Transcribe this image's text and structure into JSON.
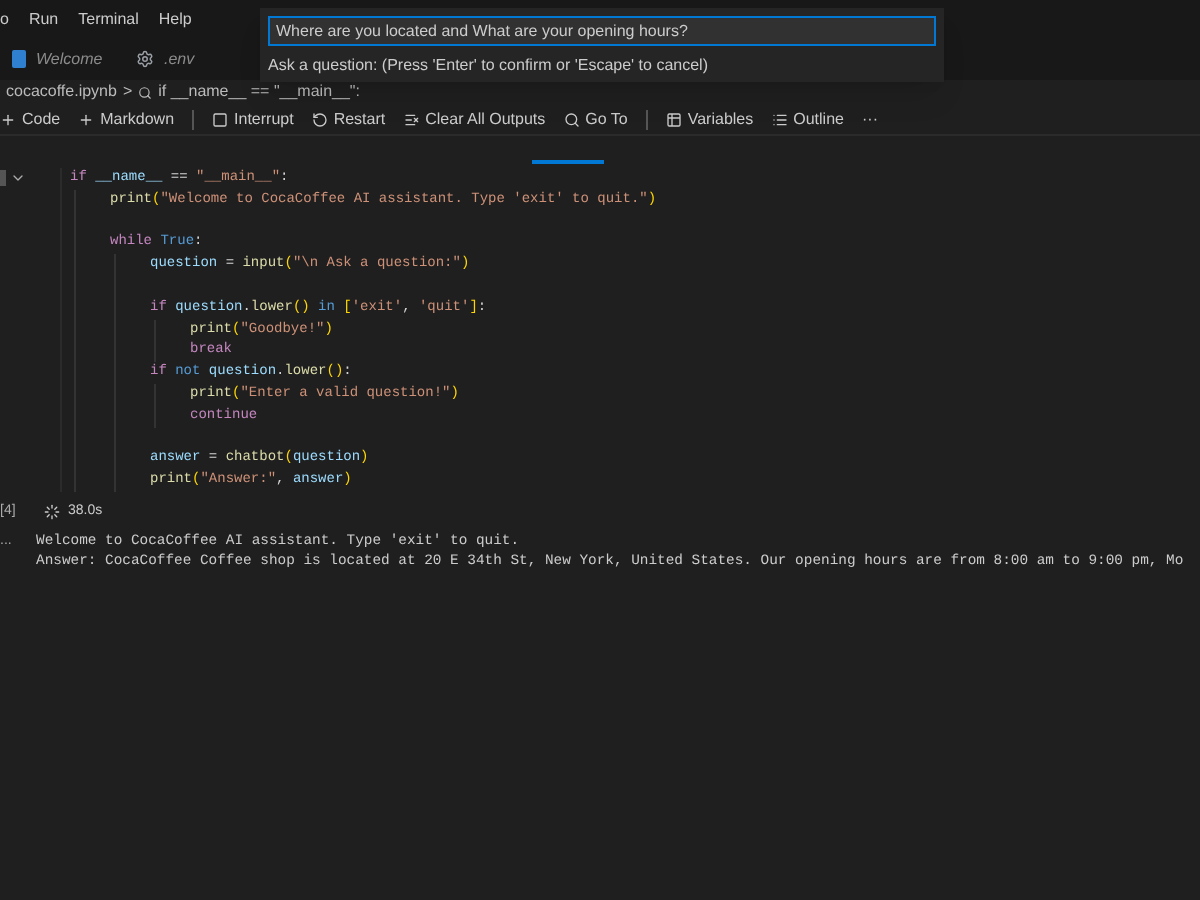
{
  "menu_bar": [
    "o",
    "Run",
    "Terminal",
    "Help"
  ],
  "tabs": [
    {
      "label": "Welcome",
      "selected": false,
      "kind": "welcome"
    },
    {
      "label": ".env",
      "selected": false,
      "kind": "settings"
    }
  ],
  "quick_input": {
    "value": "Where are you located and What are your opening hours?",
    "prompt": "Ask a question: (Press 'Enter' to confirm or 'Escape' to cancel)"
  },
  "breadcrumb": {
    "file": "cocacoffe.ipynb",
    "separator": ">",
    "symbol": "if __name__ == \"__main__\":"
  },
  "toolbar": [
    {
      "label": "Code",
      "kind": "plus"
    },
    {
      "label": "Markdown",
      "kind": "plus"
    },
    {
      "label": "Interrupt",
      "kind": "stop"
    },
    {
      "label": "Restart",
      "kind": "restart"
    },
    {
      "label": "Clear All Outputs",
      "kind": "clear"
    },
    {
      "label": "Go To",
      "kind": "goto"
    },
    {
      "label": "Variables",
      "kind": "variables"
    },
    {
      "label": "Outline",
      "kind": "outline"
    },
    {
      "label": "···",
      "kind": "more"
    }
  ],
  "cell": {
    "execution_count": "[4]",
    "duration": "38.0s",
    "code": [
      {
        "text": "if __name__ == \"__main__\":",
        "children": [
          {
            "text": "print(\"Welcome to CocaCoffee AI assistant. Type 'exit' to quit.\")"
          },
          {
            "text": "while True:",
            "gap_before": true,
            "children": [
              {
                "text": "question = input(\"\\n Ask a question:\")"
              },
              {
                "text": "if question.lower() in ['exit', 'quit']:",
                "gap_before": true,
                "children": [
                  {
                    "text": "print(\"Goodbye!\")"
                  },
                  {
                    "text": "break"
                  }
                ]
              },
              {
                "text": "if not question.lower():",
                "children": [
                  {
                    "text": "print(\"Enter a valid question!\")"
                  },
                  {
                    "text": "continue"
                  }
                ]
              },
              {
                "text": "answer = chatbot(question)",
                "gap_before": true
              },
              {
                "text": "print(\"Answer:\", answer)"
              }
            ]
          }
        ]
      }
    ]
  },
  "output": {
    "marker": "...",
    "lines": [
      "Welcome to CocaCoffee AI assistant. Type 'exit' to quit.",
      "Answer: CocaCoffee Coffee shop is located at 20 E 34th St, New York, United States. Our opening hours are from 8:00 am to 9:00 pm, Mo"
    ]
  }
}
